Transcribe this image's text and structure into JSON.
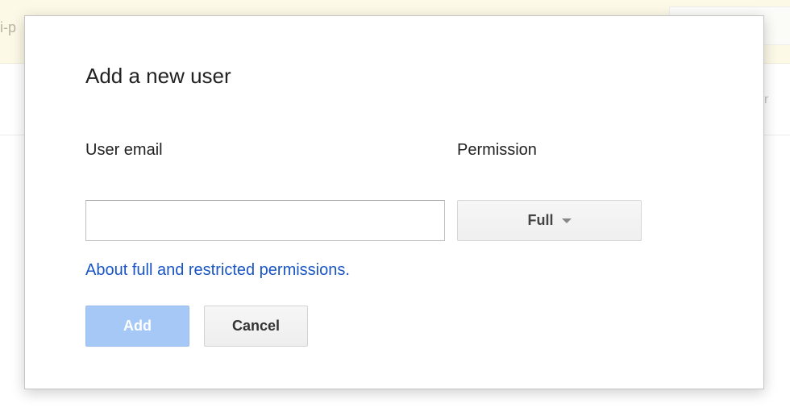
{
  "background": {
    "banner_fragment": "i-p",
    "toolbar_fragment": "r"
  },
  "dialog": {
    "title": "Add a new user",
    "email_label": "User email",
    "email_value": "",
    "email_placeholder": "",
    "permission_label": "Permission",
    "permission_value": "Full",
    "permission_caret_icon": "caret-down-icon",
    "help_link": "About full and restricted permissions.",
    "add_label": "Add",
    "add_enabled": false,
    "cancel_label": "Cancel"
  },
  "colors": {
    "link": "#1a55c5",
    "primary_button_disabled": "#a5c8f6",
    "banner": "#fdf9e7"
  }
}
